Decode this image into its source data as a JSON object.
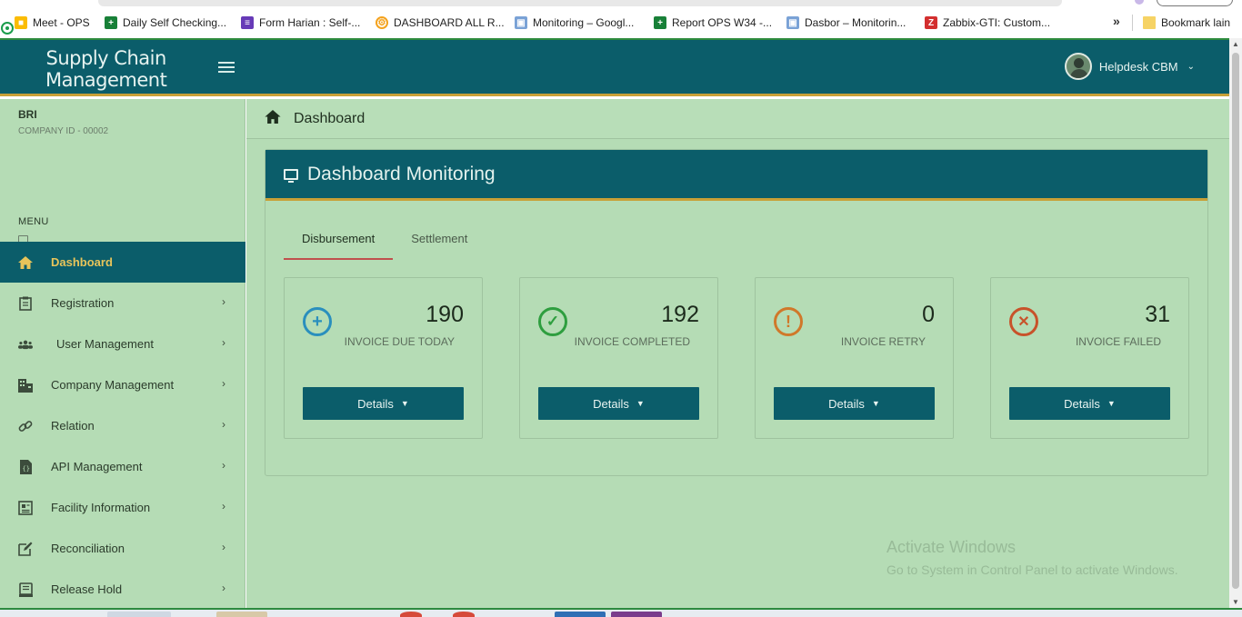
{
  "bookmarks": [
    {
      "label": "Meet - OPS",
      "color": "#34a853",
      "icon": "meet-icon"
    },
    {
      "label": "Daily Self Checking...",
      "color": "#188038",
      "icon": "sheets-icon"
    },
    {
      "label": "Form Harian : Self-...",
      "color": "#673ab7",
      "icon": "forms-icon"
    },
    {
      "label": "DASHBOARD ALL R...",
      "color": "#f4a21d",
      "icon": "grafana-icon"
    },
    {
      "label": "Monitoring – Googl...",
      "color": "#7aa2d6",
      "icon": "monitor-icon"
    },
    {
      "label": "Report OPS W34 -...",
      "color": "#188038",
      "icon": "sheets-icon"
    },
    {
      "label": "Dasbor – Monitorin...",
      "color": "#7aa2d6",
      "icon": "monitor-icon"
    },
    {
      "label": "Zabbix-GTI: Custom...",
      "color": "#d32f2f",
      "icon": "zabbix-icon"
    }
  ],
  "bookmark_more": "»",
  "other_bookmarks": "Bookmark lain",
  "header": {
    "logo_line1": "Supply Chain",
    "logo_line2": "Management",
    "user_name": "Helpdesk CBM"
  },
  "sidebar": {
    "company_name": "BRI",
    "company_id": "COMPANY ID - 00002",
    "menu_label": "MENU",
    "items": [
      {
        "label": "Dashboard",
        "icon": "home-icon",
        "active": true
      },
      {
        "label": "Registration",
        "icon": "clipboard-icon"
      },
      {
        "label": "User Management",
        "icon": "users-icon"
      },
      {
        "label": "Company Management",
        "icon": "building-icon"
      },
      {
        "label": "Relation",
        "icon": "link-icon"
      },
      {
        "label": "API Management",
        "icon": "code-file-icon"
      },
      {
        "label": "Facility Information",
        "icon": "newspaper-icon"
      },
      {
        "label": "Reconciliation",
        "icon": "edit-icon"
      },
      {
        "label": "Release Hold",
        "icon": "archive-icon"
      }
    ]
  },
  "breadcrumb": {
    "title": "Dashboard"
  },
  "panel": {
    "title": "Dashboard Monitoring",
    "tabs": [
      {
        "label": "Disbursement",
        "active": true
      },
      {
        "label": "Settlement",
        "active": false
      }
    ],
    "cards": [
      {
        "value": "190",
        "label": "INVOICE DUE TODAY",
        "icon": "plus-circle-icon",
        "color": "#2a8fbd",
        "button": "Details"
      },
      {
        "value": "192",
        "label": "INVOICE COMPLETED",
        "icon": "check-circle-icon",
        "color": "#2e9e3f",
        "button": "Details"
      },
      {
        "value": "0",
        "label": "INVOICE RETRY",
        "icon": "exclamation-circle-icon",
        "color": "#d0782a",
        "button": "Details"
      },
      {
        "value": "31",
        "label": "INVOICE FAILED",
        "icon": "x-circle-icon",
        "color": "#c8522a",
        "button": "Details"
      }
    ]
  },
  "watermark": {
    "line1": "Activate Windows",
    "line2": "Go to System in Control Panel to activate Windows."
  }
}
